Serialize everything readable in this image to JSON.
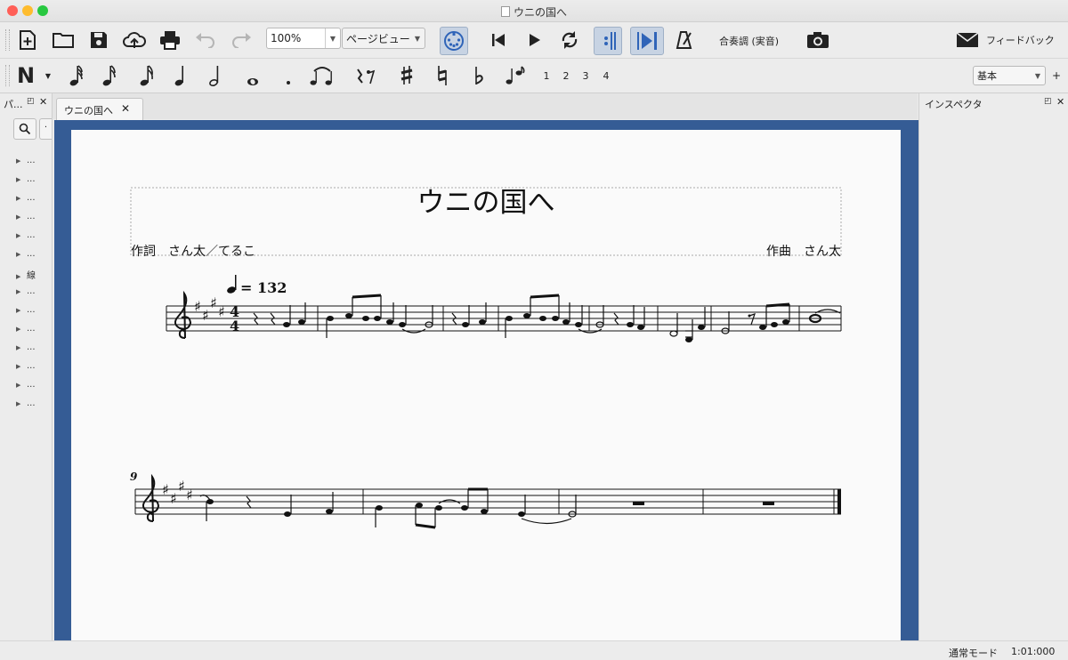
{
  "window": {
    "title": "ウニの国へ",
    "controls": {
      "close": "#ff5f57",
      "minimize": "#febc2e",
      "zoom": "#28c840"
    }
  },
  "toolbar": {
    "zoom_value": "100%",
    "view_mode": "ページビュー",
    "concert_pitch_label": "合奏調 (実音)",
    "feedback_label": "フィードバック",
    "accent": "#2f64b8"
  },
  "note_input": {
    "mode_glyph": "N",
    "tuplets": [
      "1",
      "2",
      "3",
      "4"
    ],
    "workspace": "基本"
  },
  "palettes": {
    "title": "パ...",
    "items": [
      "...",
      "...",
      "...",
      "...",
      "...",
      "...",
      "線",
      "...",
      "...",
      "...",
      "...",
      "...",
      "...",
      "...",
      "..."
    ]
  },
  "tab": {
    "label": "ウニの国へ"
  },
  "inspector": {
    "title": "インスペクタ"
  },
  "score": {
    "title": "ウニの国へ",
    "lyricist": "作詞　さん太／てるこ",
    "composer": "作曲　さん太",
    "tempo_text": "= 132",
    "time_signature": {
      "numerator": "4",
      "denominator": "4"
    },
    "key_sharps": 4,
    "system2_measure_number": "9",
    "measures_per_system": [
      8,
      4
    ]
  },
  "status": {
    "mode": "通常モード",
    "position": "1:01:000"
  }
}
